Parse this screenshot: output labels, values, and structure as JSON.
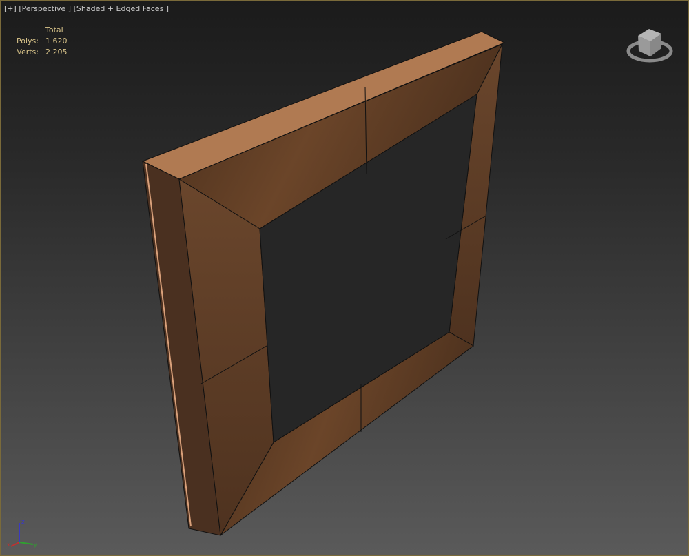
{
  "viewport": {
    "menu_label": "[+]",
    "view_label": "[Perspective ]",
    "shading_label": "[Shaded + Edged Faces ]",
    "border_color": "#7a6a3a"
  },
  "stats": {
    "header": "Total",
    "rows": [
      {
        "label": "Polys:",
        "value": "1 620"
      },
      {
        "label": "Verts:",
        "value": "2 205"
      }
    ]
  },
  "viewcube": {
    "icon": "viewcube-icon"
  },
  "axis_gizmo": {
    "z_label": "z",
    "x_label": "x",
    "y_label": "y"
  },
  "model": {
    "wood_color": "#5a3a22",
    "edge_color": "#c89a72"
  }
}
